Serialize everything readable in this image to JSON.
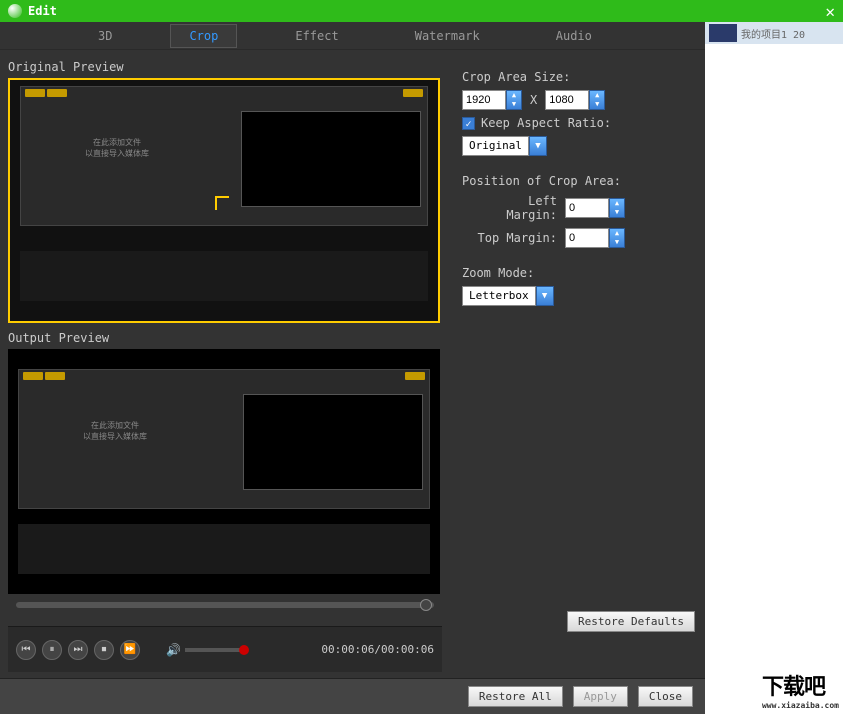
{
  "title": "Edit",
  "tabs": [
    "3D",
    "Crop",
    "Effect",
    "Watermark",
    "Audio"
  ],
  "activeTab": 1,
  "originalLabel": "Original Preview",
  "outputLabel": "Output Preview",
  "innerText1": "在此添加文件",
  "innerText2": "以直接导入媒体库",
  "innerText3": "媒体库",
  "timecode": "00:00:06/00:00:06",
  "crop": {
    "sizeLabel": "Crop Area Size:",
    "width": "1920",
    "height": "1080",
    "x": "X",
    "keepRatio": "Keep Aspect Ratio:",
    "ratioChecked": true,
    "ratioSelect": "Original"
  },
  "position": {
    "label": "Position of Crop Area:",
    "leftLabel": "Left Margin:",
    "leftVal": "0",
    "topLabel": "Top Margin:",
    "topVal": "0"
  },
  "zoom": {
    "label": "Zoom Mode:",
    "value": "Letterbox"
  },
  "restoreDefaults": "Restore Defaults",
  "footer": {
    "restoreAll": "Restore All",
    "apply": "Apply",
    "close": "Close"
  },
  "side": {
    "item": "我的项目1 20"
  },
  "logo": "下载吧",
  "logoSub": "www.xiazaiba.com"
}
